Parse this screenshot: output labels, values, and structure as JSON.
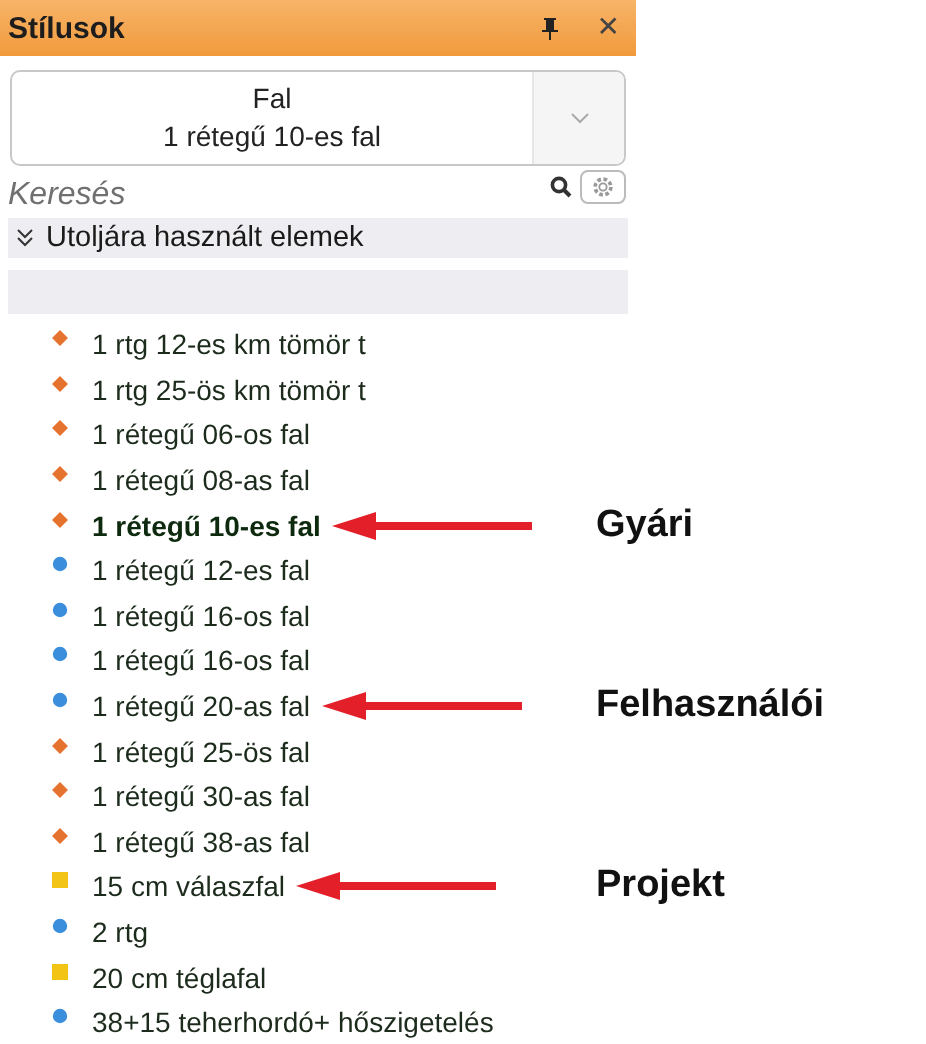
{
  "window": {
    "title": "Stílusok",
    "buttons": [
      "✕"
    ]
  },
  "dropdown": {
    "line1": "Fal",
    "line2": "1 rétegű 10-es fal"
  },
  "search": {
    "placeholder": "Keresés"
  },
  "section": {
    "title": "Utoljára használt elemek",
    "expanded": true
  },
  "items": [
    {
      "label": "1 rtg 12-es km tömör t",
      "kind": "diamond",
      "selected": false
    },
    {
      "label": "1 rtg 25-ös km tömör t",
      "kind": "diamond",
      "selected": false
    },
    {
      "label": "1 rétegű 06-os fal",
      "kind": "diamond",
      "selected": false
    },
    {
      "label": "1 rétegű 08-as fal",
      "kind": "diamond",
      "selected": false
    },
    {
      "label": "1 rétegű 10-es fal",
      "kind": "diamond",
      "selected": true,
      "annotation": "Gyári"
    },
    {
      "label": "1 rétegű 12-es fal",
      "kind": "circle",
      "selected": false
    },
    {
      "label": "1 rétegű 16-os fal",
      "kind": "circle",
      "selected": false
    },
    {
      "label": "1 rétegű 16-os fal",
      "kind": "circle",
      "selected": false
    },
    {
      "label": "1 rétegű 20-as fal",
      "kind": "circle",
      "selected": false,
      "annotation": "Felhasználói"
    },
    {
      "label": "1 rétegű 25-ös fal",
      "kind": "diamond",
      "selected": false
    },
    {
      "label": "1 rétegű 30-as fal",
      "kind": "diamond",
      "selected": false
    },
    {
      "label": "1 rétegű 38-as fal",
      "kind": "diamond",
      "selected": false
    },
    {
      "label": "15 cm válaszfal",
      "kind": "square",
      "selected": false,
      "annotation": "Projekt"
    },
    {
      "label": "2 rtg",
      "kind": "circle",
      "selected": false
    },
    {
      "label": "20 cm téglafal",
      "kind": "square",
      "selected": false
    },
    {
      "label": "38+15 teherhordó+ hőszigetelés",
      "kind": "circle",
      "selected": false
    }
  ]
}
